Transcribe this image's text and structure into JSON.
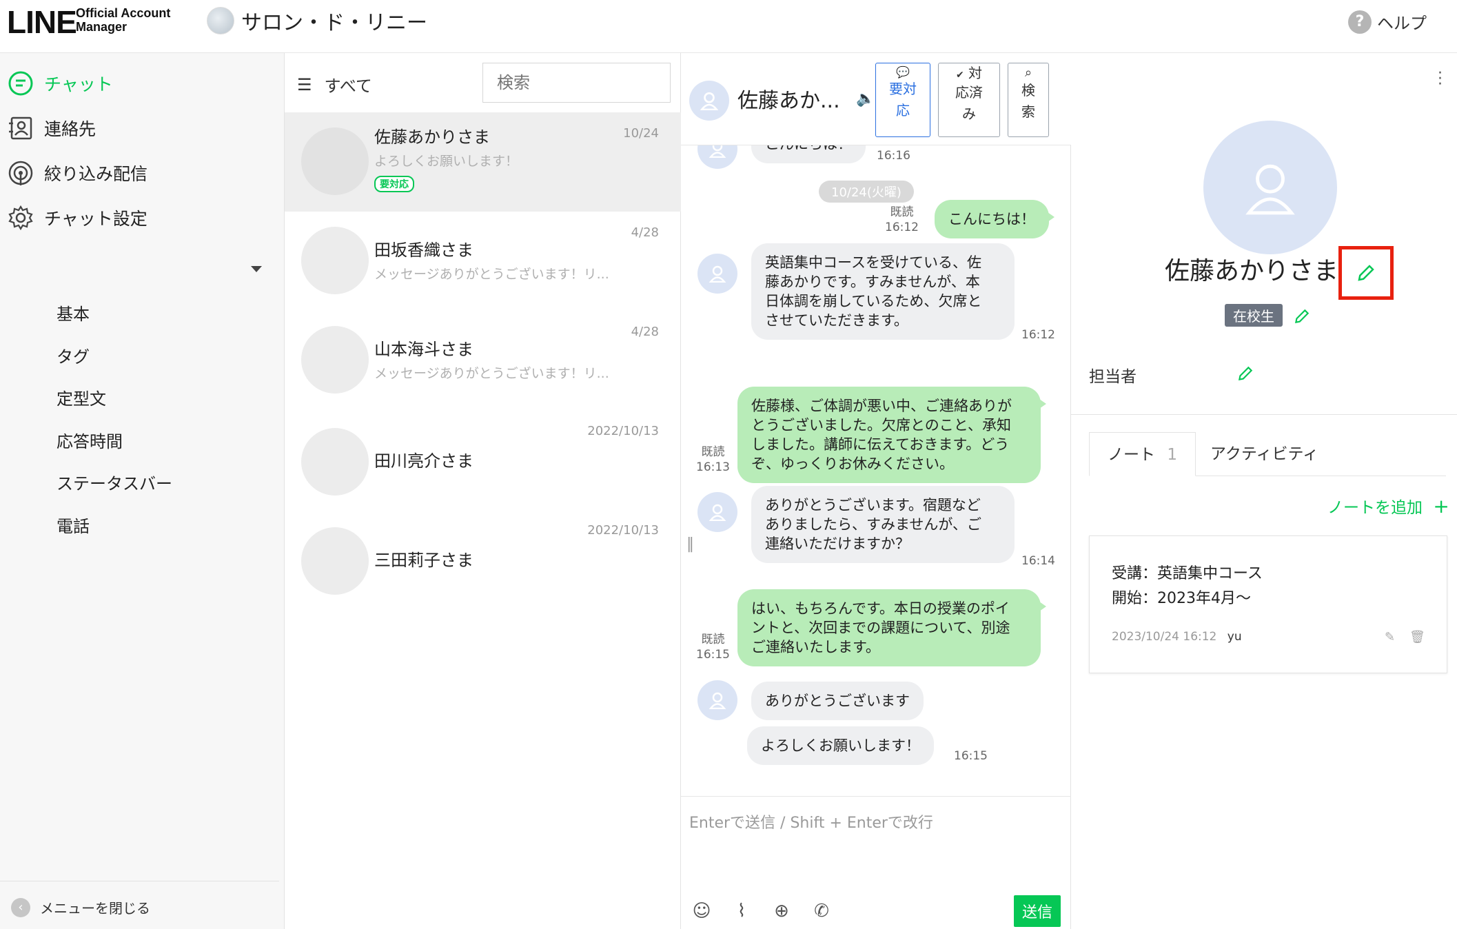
{
  "header": {
    "logo_line": "LINE",
    "logo_oa_1": "Official Account",
    "logo_oa_2": "Manager",
    "account_name": "サロン・ド・リニー",
    "help_label": "ヘルプ"
  },
  "sidebar": {
    "items": [
      {
        "label": "チャット",
        "icon": "chat-icon"
      },
      {
        "label": "連絡先",
        "icon": "contacts-icon"
      },
      {
        "label": "絞り込み配信",
        "icon": "broadcast-icon"
      },
      {
        "label": "チャット設定",
        "icon": "gear-icon"
      }
    ],
    "sub_items": [
      "基本",
      "タグ",
      "定型文",
      "応答時間",
      "ステータスバー",
      "電話"
    ],
    "close_menu": "メニューを閉じる"
  },
  "chatlist": {
    "filter_label": "すべて",
    "search_placeholder": "検索",
    "items": [
      {
        "name": "佐藤あかりさま",
        "preview": "よろしくお願いします！",
        "date": "10/24",
        "badge": "要対応"
      },
      {
        "name": "田坂香織さま",
        "preview": "メッセージありがとうございます！リ...",
        "date": "4/28"
      },
      {
        "name": "山本海斗さま",
        "preview": "メッセージありがとうございます！リ...",
        "date": "4/28"
      },
      {
        "name": "田川亮介さま",
        "preview": "",
        "date": "2022/10/13"
      },
      {
        "name": "三田莉子さま",
        "preview": "",
        "date": "2022/10/13"
      }
    ]
  },
  "conversation": {
    "name": "佐藤あか...",
    "buttons": {
      "needs_action": [
        "要対",
        "応"
      ],
      "done": [
        "対",
        "応済",
        "み"
      ],
      "search": [
        "検",
        "索"
      ]
    },
    "partial_top_time": "16:16",
    "partial_top_text": "こんにちは！",
    "date_divider": "10/24(火曜)",
    "read_label": "既読",
    "messages": [
      {
        "dir": "out",
        "text": "こんにちは！",
        "time": "16:12",
        "read": true
      },
      {
        "dir": "in",
        "lines": [
          "英語集中コースを受けている、佐",
          "藤あかりです。すみませんが、本",
          "日体調を崩しているため、欠席と",
          "させていただきます。"
        ],
        "time": "16:12"
      },
      {
        "dir": "out",
        "lines": [
          "佐藤様、ご体調が悪い中、ご連絡ありが",
          "とうございました。欠席とのこと、承知",
          "しました。講師に伝えておきます。どう",
          "ぞ、ゆっくりお休みください。"
        ],
        "time": "16:13",
        "read": true
      },
      {
        "dir": "in",
        "lines": [
          "ありがとうございます。宿題など",
          "ありましたら、すみませんが、ご",
          "連絡いただけますか？"
        ],
        "time": "16:14"
      },
      {
        "dir": "out",
        "lines": [
          "はい、もちろんです。本日の授業のポイ",
          "ントと、次回までの課題について、別途",
          "ご連絡いたします。"
        ],
        "time": "16:15",
        "read": true
      },
      {
        "dir": "in",
        "text": "ありがとうございます"
      },
      {
        "dir": "in",
        "text": "よろしくお願いします！",
        "time": "16:15"
      }
    ],
    "input_placeholder": "Enterで送信 / Shift + Enterで改行",
    "send_label": "送信"
  },
  "profile": {
    "name": "佐藤あかりさま",
    "tag": "在校生",
    "assignee_label": "担当者",
    "tabs": [
      {
        "label": "ノート",
        "count": "1"
      },
      {
        "label": "アクティビティ"
      }
    ],
    "add_note": "ノートを追加",
    "note": {
      "line1": "受講：英語集中コース",
      "line2": "開始：2023年4月〜",
      "timestamp": "2023/10/24 16:12",
      "author": "yu"
    }
  },
  "colors": {
    "brand_green": "#06c755",
    "outgoing_bubble": "#b8ecb8",
    "incoming_bubble": "#eeeff1",
    "highlight_red": "#e8210f",
    "accent_blue": "#2a6fe0"
  }
}
